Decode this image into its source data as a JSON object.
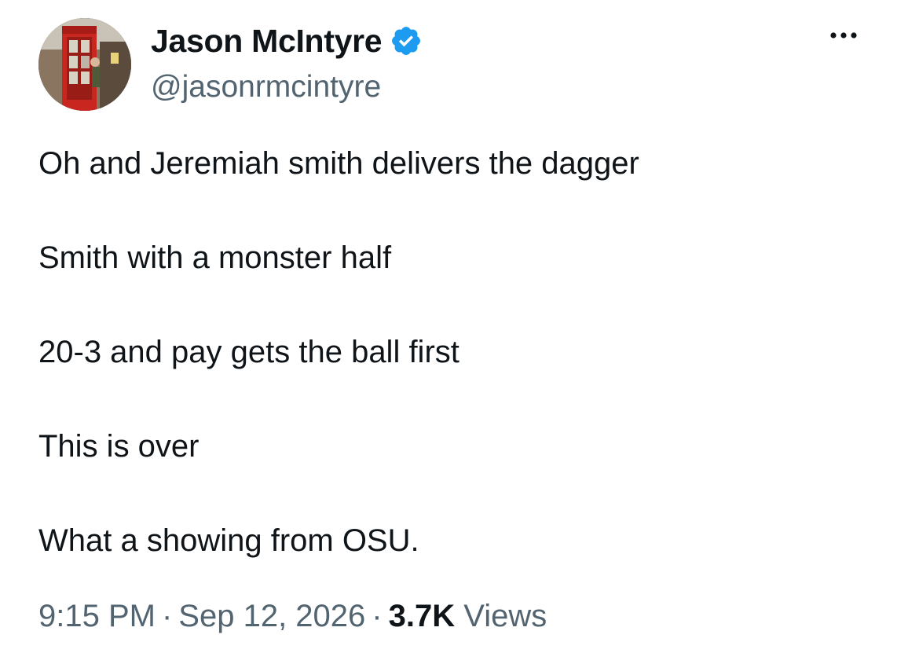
{
  "author": {
    "display_name": "Jason McIntyre",
    "handle": "@jasonrmcintyre",
    "verified_icon": "verified-badge-icon",
    "verified_color": "#1d9bf0"
  },
  "more_icon": "ellipsis-icon",
  "tweet": {
    "lines": [
      "Oh and Jeremiah smith delivers the dagger",
      "Smith with a monster half",
      "20-3 and pay gets the ball first",
      "This is over",
      "What a showing from OSU."
    ]
  },
  "meta": {
    "time": "9:15 PM",
    "separator": "·",
    "date": "Sep 12, 2026",
    "views_count": "3.7K",
    "views_label": "Views"
  },
  "colors": {
    "text_primary": "#0f1419",
    "text_secondary": "#536471",
    "accent": "#1d9bf0"
  }
}
